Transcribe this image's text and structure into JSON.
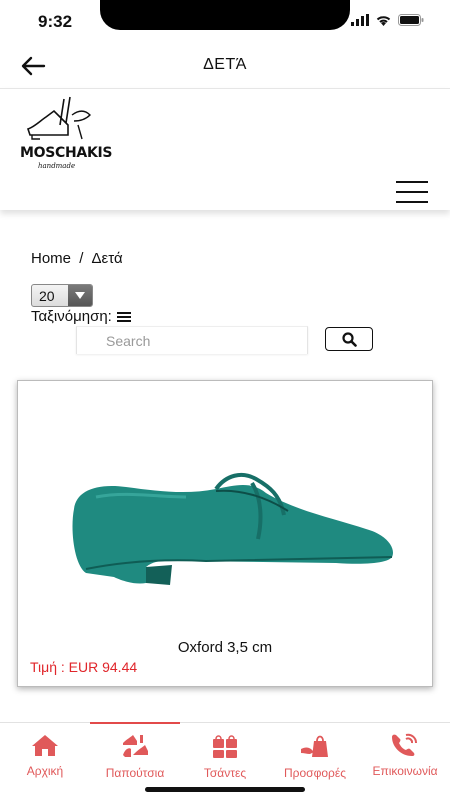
{
  "status_bar": {
    "time": "9:32"
  },
  "header": {
    "title": "ΔΕΤΆ"
  },
  "logo": {
    "name": "MOSCHAKIS",
    "tagline": "handmade"
  },
  "breadcrumb": {
    "home": "Home",
    "separator": "/",
    "current": "Δετά"
  },
  "controls": {
    "per_page": "20",
    "sort_label": "Ταξινόμηση:",
    "search_placeholder": "Search"
  },
  "product": {
    "name": "Oxford 3,5 cm",
    "price": "Τιμή : EUR 94.44",
    "shoe_color": "#1f8a80"
  },
  "tabs": [
    {
      "label": "Αρχική",
      "icon": "home-icon",
      "active": false
    },
    {
      "label": "Παπούτσια",
      "icon": "shoes-icon",
      "active": true
    },
    {
      "label": "Τσάντες",
      "icon": "bags-icon",
      "active": false
    },
    {
      "label": "Προσφορές",
      "icon": "offers-icon",
      "active": false
    },
    {
      "label": "Επικοινωνία",
      "icon": "contact-icon",
      "active": false
    }
  ],
  "colors": {
    "accent": "#e0595a",
    "price": "#e0262b"
  }
}
